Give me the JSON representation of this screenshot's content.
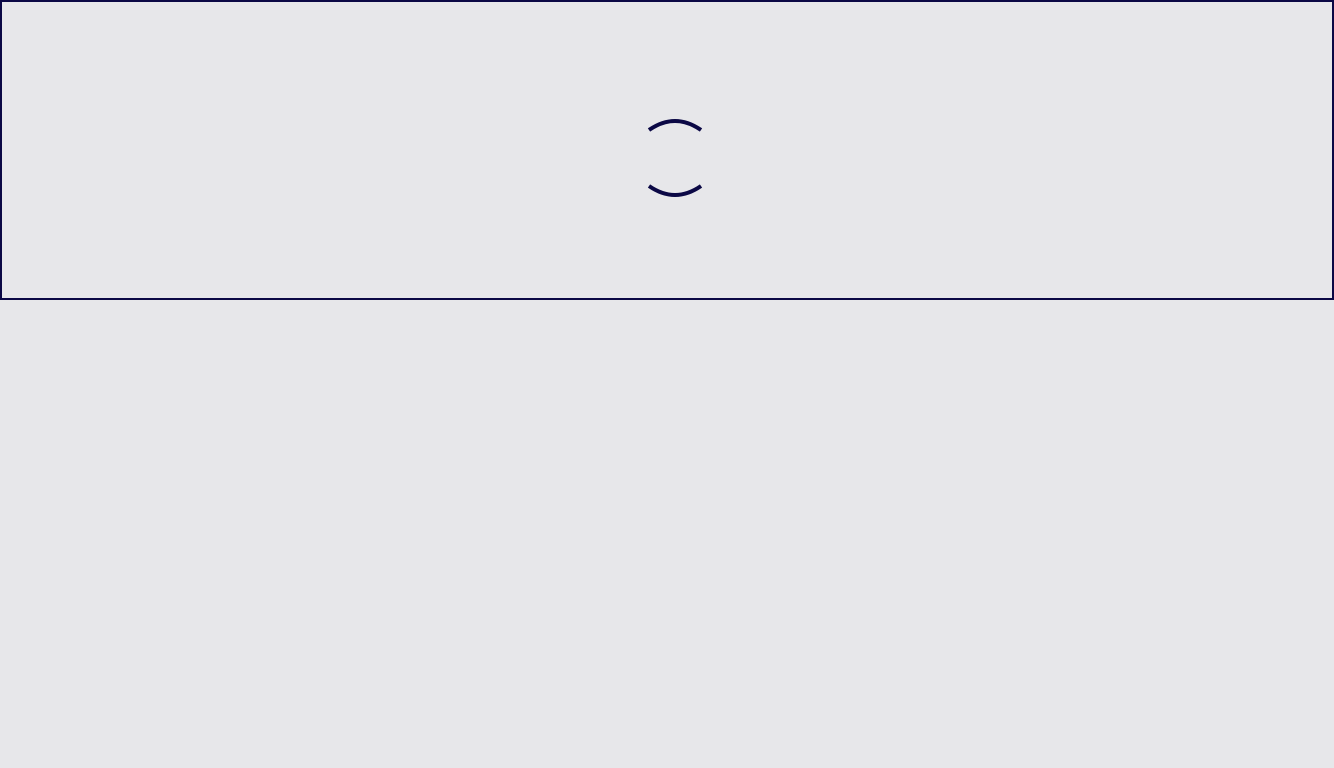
{
  "page": {
    "background_color": "#e7e7ea"
  },
  "loading_panel": {
    "border_color": "#0b0845",
    "spinner": {
      "icon": "loading-spinner-icon",
      "color": "#0b0845"
    }
  }
}
